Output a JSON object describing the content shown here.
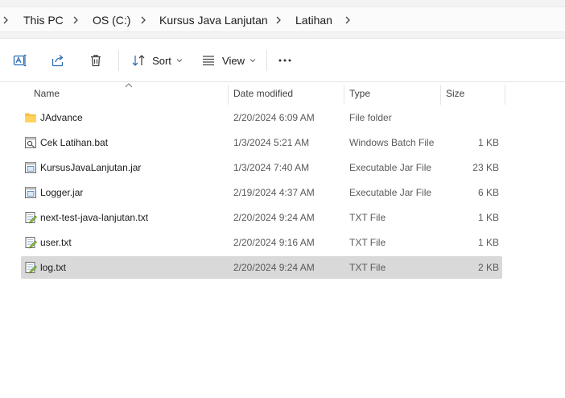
{
  "breadcrumb": {
    "items": [
      "This PC",
      "OS (C:)",
      "Kursus Java Lanjutan",
      "Latihan"
    ]
  },
  "toolbar": {
    "sort_label": "Sort",
    "view_label": "View"
  },
  "columns": {
    "name": "Name",
    "date": "Date modified",
    "type": "Type",
    "size": "Size"
  },
  "files": [
    {
      "name": "JAdvance",
      "date": "2/20/2024 6:09 AM",
      "type": "File folder",
      "size": "",
      "icon": "folder-icon"
    },
    {
      "name": "Cek Latihan.bat",
      "date": "1/3/2024 5:21 AM",
      "type": "Windows Batch File",
      "size": "1 KB",
      "icon": "batch-file-icon"
    },
    {
      "name": "KursusJavaLanjutan.jar",
      "date": "1/3/2024 7:40 AM",
      "type": "Executable Jar File",
      "size": "23 KB",
      "icon": "jar-file-icon"
    },
    {
      "name": "Logger.jar",
      "date": "2/19/2024 4:37 AM",
      "type": "Executable Jar File",
      "size": "6 KB",
      "icon": "jar-file-icon"
    },
    {
      "name": "next-test-java-lanjutan.txt",
      "date": "2/20/2024 9:24 AM",
      "type": "TXT File",
      "size": "1 KB",
      "icon": "text-file-icon"
    },
    {
      "name": "user.txt",
      "date": "2/20/2024 9:16 AM",
      "type": "TXT File",
      "size": "1 KB",
      "icon": "text-file-icon"
    },
    {
      "name": "log.txt",
      "date": "2/20/2024 9:24 AM",
      "type": "TXT File",
      "size": "2 KB",
      "icon": "text-file-icon",
      "selected": true
    }
  ]
}
